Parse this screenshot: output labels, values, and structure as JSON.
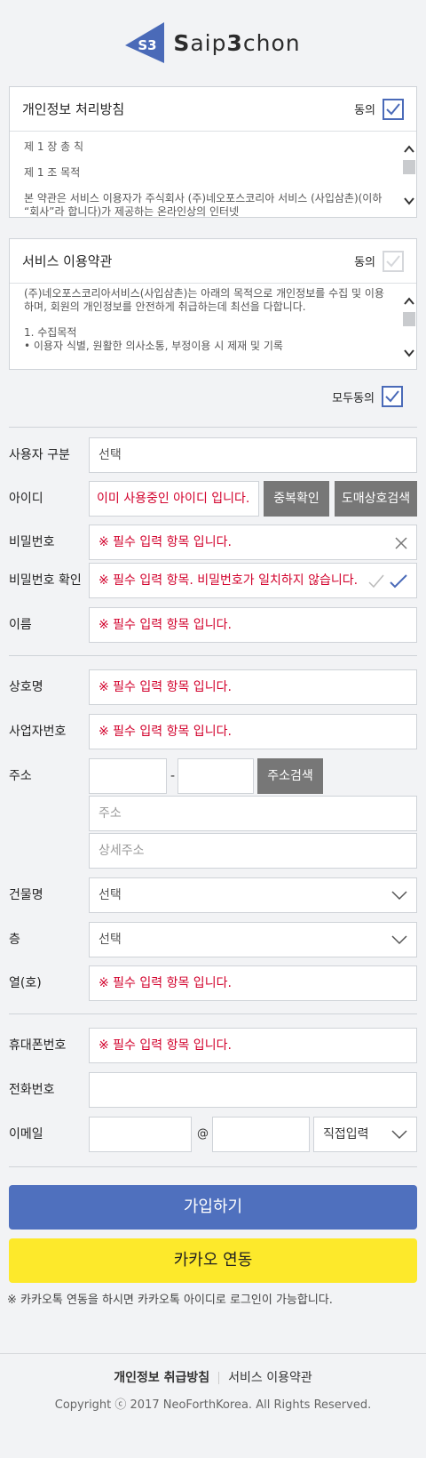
{
  "brand": {
    "mark": "S3",
    "name_bold": "S",
    "name_rest_a": "aip",
    "name_bold_b": "3",
    "name_rest_b": "chon",
    "color": "#4a6ab8"
  },
  "terms_privacy": {
    "title": "개인정보 처리방침",
    "agree_label": "동의",
    "checked": true,
    "lines": [
      "제 1 장 총 칙",
      "제 1 조 목적",
      "본 약관은 서비스 이용자가 주식회사 (주)네오포스코리아 서비스 (사입삼촌)(이하 “회사”라 합니다)가 제공하는 온라인상의 인터넷"
    ]
  },
  "terms_service": {
    "title": "서비스 이용약관",
    "agree_label": "동의",
    "checked": false,
    "paragraph": "(주)네오포스코리아서비스(사입삼촌)는 아래의 목적으로 개인정보를 수집 및 이용하며, 회원의 개인정보를 안전하게 취급하는데 최선을 다합니다.",
    "item_title": "1. 수집목적",
    "item_bullet": "• 이용자 식별, 원활한 의사소통, 부정이용 시 제재 및 기록"
  },
  "all_agree": {
    "label": "모두동의",
    "checked": true
  },
  "form": {
    "user_type": {
      "label": "사용자 구분",
      "value": "선택"
    },
    "user_id": {
      "label": "아이디",
      "error": "이미 사용중인 아이디 입니다.",
      "dup_check": "중복확인",
      "wholesale_search": "도매상호검색"
    },
    "password": {
      "label": "비밀번호",
      "error": "※ 필수 입력 항목 입니다."
    },
    "password_confirm": {
      "label": "비밀번호 확인",
      "error": "※ 필수 입력 항목. 비밀번호가 일치하지 않습니다."
    },
    "name": {
      "label": "이름",
      "error": "※ 필수 입력 항목 입니다."
    },
    "company_name": {
      "label": "상호명",
      "error": "※ 필수 입력 항목 입니다."
    },
    "business_number": {
      "label": "사업자번호",
      "error": "※ 필수 입력 항목 입니다."
    },
    "address": {
      "label": "주소",
      "dash": "-",
      "search": "주소검색",
      "addr_placeholder": "주소",
      "detail_placeholder": "상세주소"
    },
    "building": {
      "label": "건물명",
      "value": "선택"
    },
    "floor": {
      "label": "층",
      "value": "선택"
    },
    "unit": {
      "label": "열(호)",
      "error": "※ 필수 입력 항목 입니다."
    },
    "mobile": {
      "label": "휴대폰번호",
      "error": "※ 필수 입력 항목 입니다."
    },
    "phone": {
      "label": "전화번호"
    },
    "email": {
      "label": "이메일",
      "at": "@",
      "domain_select": "직접입력"
    }
  },
  "buttons": {
    "join": "가입하기",
    "kakao": "카카오 연동"
  },
  "kakao_note": "※ 카카오톡 연동을 하시면 카카오톡 아이디로 로그인이 가능합니다.",
  "footer": {
    "privacy": "개인정보 취급방침",
    "terms": "서비스 이용약관",
    "copyright": "Copyright ⓒ 2017 NeoForthKorea. All Rights Reserved."
  }
}
